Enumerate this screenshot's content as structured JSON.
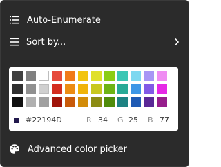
{
  "menu": {
    "auto_enumerate": {
      "label": "Auto-Enumerate",
      "icon": "numbered-list-icon"
    },
    "sort_by": {
      "label": "Sort by...",
      "icon": "hamburger-lines-icon",
      "submenu_icon": "chevron-right-icon"
    },
    "advanced_color_picker": {
      "label": "Advanced color picker",
      "icon": "palette-icon"
    }
  },
  "palette": {
    "rows": [
      [
        "#404040",
        "#808080",
        "#ffffff",
        "#e64a3c",
        "#f07a1a",
        "#f2c40f",
        "#e0e02a",
        "#8ccd14",
        "#3cc6b4",
        "#7ed8f0",
        "#a896f5",
        "#ef8cf2"
      ],
      [
        "#303030",
        "#909090",
        "#d0d0d0",
        "#d42d20",
        "#ec8c14",
        "#f0b40a",
        "#c8c81e",
        "#6eb414",
        "#28aa96",
        "#3c96e6",
        "#825ae6",
        "#e628e6"
      ],
      [
        "#101010",
        "#b0b0b0",
        "#a0a0a0",
        "#a0140a",
        "#c85a0a",
        "#d28c0a",
        "#8c8c14",
        "#508c0a",
        "#1e8282",
        "#1e5ab4",
        "#5a2896",
        "#961e8c"
      ]
    ],
    "light_swatches": [
      "#ffffff",
      "#d0d0d0"
    ],
    "current": {
      "hex": "#22194D",
      "r_label": "R",
      "r": "34",
      "g_label": "G",
      "g": "25",
      "b_label": "B",
      "b": "77"
    }
  },
  "colors": {
    "menu_background": "#2b2b2b",
    "text": "#ffffff",
    "separator": "#3d3d3d",
    "palette_background": "#ffffff"
  }
}
